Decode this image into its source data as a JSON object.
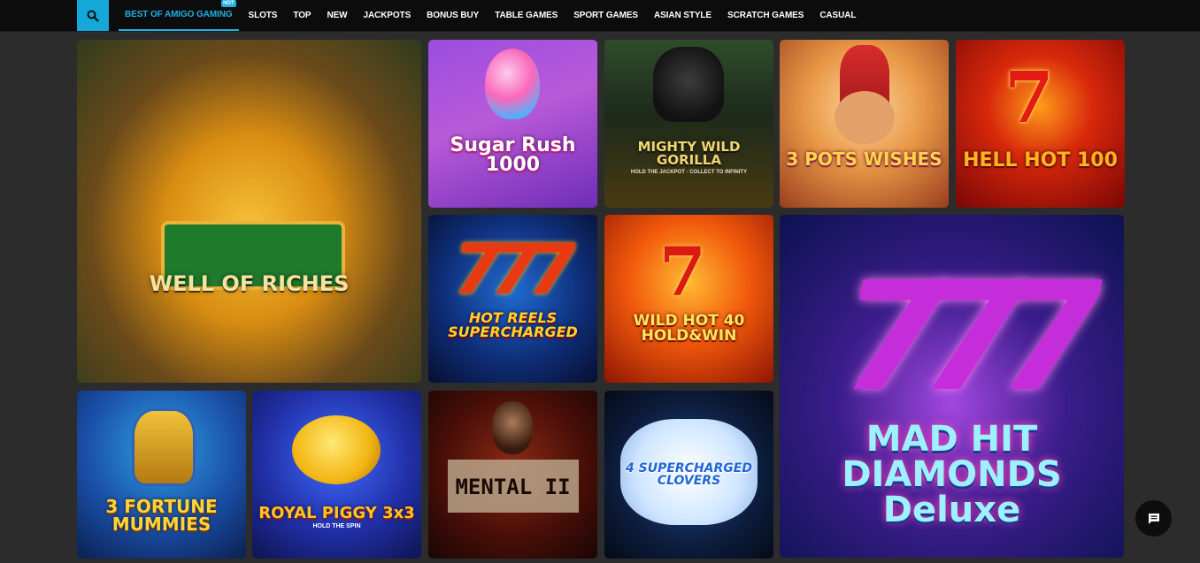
{
  "nav": {
    "items": [
      {
        "label": "BEST OF AMIGO GAMING",
        "badge": "HOT",
        "active": true
      },
      {
        "label": "SLOTS"
      },
      {
        "label": "TOP"
      },
      {
        "label": "NEW"
      },
      {
        "label": "JACKPOTS"
      },
      {
        "label": "BONUS BUY"
      },
      {
        "label": "TABLE GAMES"
      },
      {
        "label": "SPORT GAMES"
      },
      {
        "label": "ASIAN STYLE"
      },
      {
        "label": "SCRATCH GAMES"
      },
      {
        "label": "CASUAL"
      }
    ]
  },
  "games": [
    {
      "title": "WELL OF RICHES"
    },
    {
      "title": "Sugar Rush 1000"
    },
    {
      "title": "MIGHTY WILD GORILLA",
      "subtitle": "HOLD THE JACKPOT · COLLECT TO INFINITY"
    },
    {
      "title": "3 POTS WISHES"
    },
    {
      "title": "HELL HOT 100"
    },
    {
      "title": "HOT REELS SUPERCHARGED"
    },
    {
      "title": "WILD HOT 40 HOLD&WIN"
    },
    {
      "title": "MAD HIT DIAMONDS Deluxe"
    },
    {
      "title": "3 FORTUNE MUMMIES"
    },
    {
      "title": "ROYAL PIGGY 3x3",
      "subtitle": "HOLD THE SPIN"
    },
    {
      "title": "MENTAL II"
    },
    {
      "title": "4 SUPERCHARGED CLOVERS"
    }
  ],
  "icons": {
    "search": "search-icon",
    "chat": "chat-icon"
  },
  "colors": {
    "accent": "#1fb0e3",
    "topbar": "#0c0c0c",
    "background": "#2c2c2c"
  }
}
